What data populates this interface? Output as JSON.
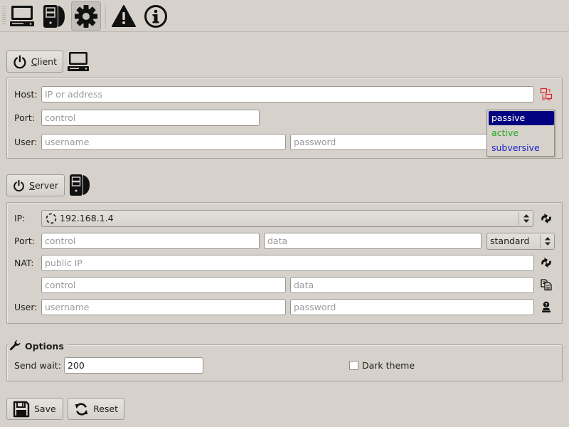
{
  "toolbar": {
    "buttons": [
      {
        "name": "client-view",
        "icon": "computer-icon",
        "active": false
      },
      {
        "name": "server-view",
        "icon": "server-tower-icon",
        "active": false
      },
      {
        "name": "settings-view",
        "icon": "gear-icon",
        "active": true
      },
      {
        "name": "warnings-view",
        "icon": "warning-icon",
        "active": false
      },
      {
        "name": "about-view",
        "icon": "info-icon",
        "active": false
      }
    ]
  },
  "client": {
    "button_label_mnemonic": "C",
    "button_label_rest": "lient",
    "host": {
      "label": "Host:",
      "value": "",
      "placeholder": "IP or address"
    },
    "port": {
      "label": "Port:",
      "value": "",
      "placeholder": "control"
    },
    "user": {
      "label": "User:",
      "username_placeholder": "username",
      "password_placeholder": "password"
    },
    "mode_dropdown": {
      "options": [
        {
          "label": "passive",
          "color": "#ffffff",
          "selected": true
        },
        {
          "label": "active",
          "color": "#22aa22",
          "selected": false
        },
        {
          "label": "subversive",
          "color": "#2222cc",
          "selected": false
        }
      ],
      "selected_bg": "#000080"
    },
    "connection_icon_color": "#dd2222"
  },
  "server": {
    "button_label_mnemonic": "S",
    "button_label_rest": "erver",
    "ip": {
      "label": "IP:",
      "value": "192.168.1.4"
    },
    "port": {
      "label": "Port:",
      "control_placeholder": "control",
      "data_placeholder": "data",
      "mode_value": "standard"
    },
    "nat": {
      "label": "NAT:",
      "public_ip_placeholder": "public IP",
      "control_placeholder": "control",
      "data_placeholder": "data"
    },
    "user": {
      "label": "User:",
      "username_placeholder": "username",
      "password_placeholder": "password"
    }
  },
  "options": {
    "title": "Options",
    "send_wait": {
      "label": "Send wait:",
      "value": "200"
    },
    "dark_theme": {
      "label": "Dark theme",
      "checked": false
    }
  },
  "footer": {
    "save_label": "Save",
    "reset_label": "Reset"
  }
}
